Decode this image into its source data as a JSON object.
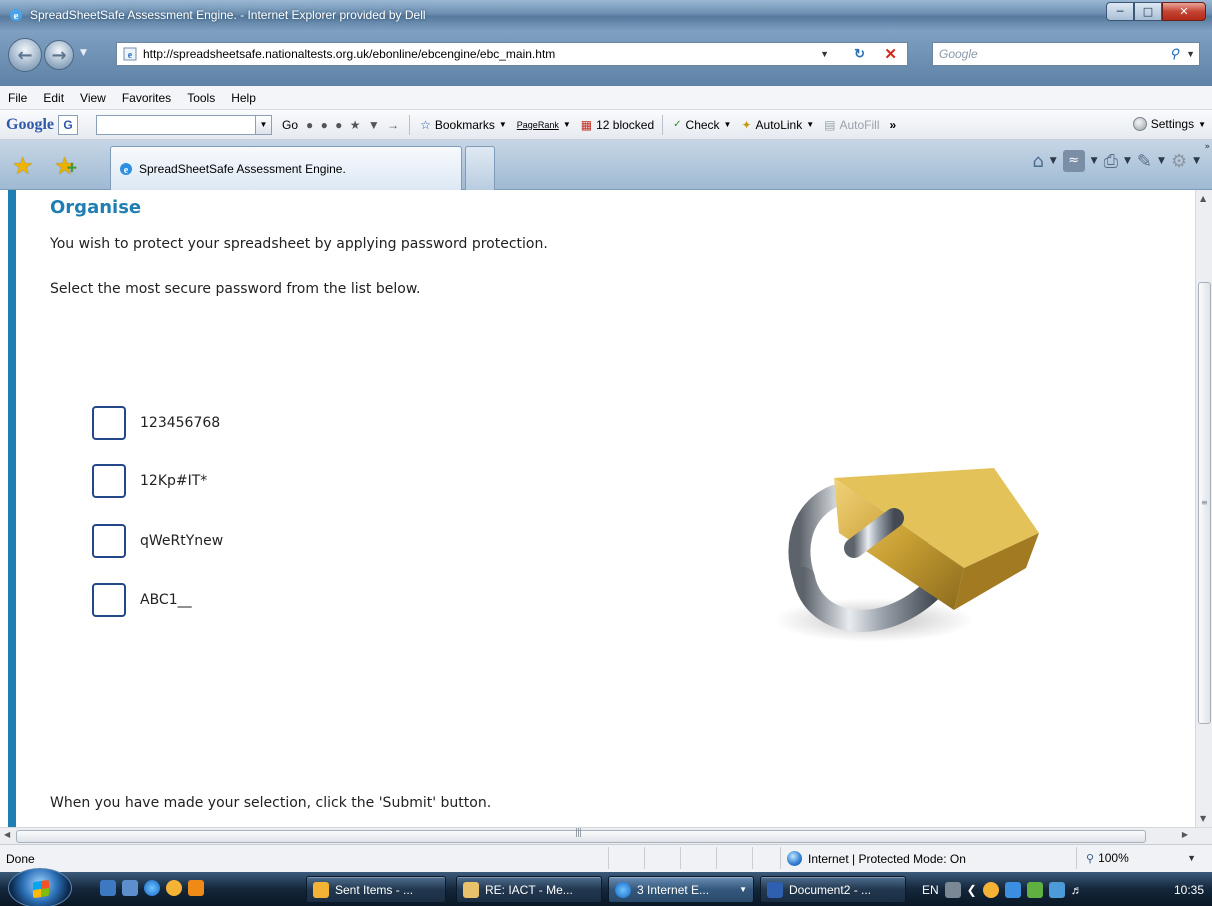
{
  "window": {
    "title": "SpreadSheetSafe Assessment Engine. - Internet Explorer provided by Dell",
    "controls": [
      "minimize-icon",
      "maximize-icon",
      "close-icon"
    ]
  },
  "address_bar": {
    "url": "http://spreadsheetsafe.nationaltests.org.uk/ebonline/ebcengine/ebc_main.htm",
    "search_placeholder": "Google"
  },
  "menu": [
    "File",
    "Edit",
    "View",
    "Favorites",
    "Tools",
    "Help"
  ],
  "google_toolbar": {
    "logo": "Google",
    "go_label": "Go",
    "bookmarks_label": "Bookmarks",
    "pagerank_label": "PageRank",
    "blocked_label": "12 blocked",
    "check_label": "Check",
    "autolink_label": "AutoLink",
    "autofill_label": "AutoFill",
    "more_label": "»",
    "settings_label": "Settings"
  },
  "tab": {
    "label": "SpreadSheetSafe Assessment Engine."
  },
  "content": {
    "heading": "Organise",
    "instruction1": "You wish to protect your spreadsheet by applying password protection.",
    "instruction2": "Select the most secure password from the list below.",
    "options": [
      "123456768",
      "12Kp#IT*",
      "qWeRtYnew",
      "ABC1__"
    ],
    "footer": "When you have made your selection, click the 'Submit' button."
  },
  "status_bar": {
    "status": "Done",
    "zone": "Internet | Protected Mode: On",
    "zoom": "100%"
  },
  "taskbar": {
    "tasks": [
      "Sent Items - ...",
      "RE: IACT - Me...",
      "3 Internet E...",
      "Document2 - ..."
    ],
    "language": "EN",
    "clock": "10:35"
  },
  "colors": {
    "heading": "#1f7fb3",
    "accent_bar": "#1f7fb3",
    "checkbox_border": "#24478a"
  }
}
